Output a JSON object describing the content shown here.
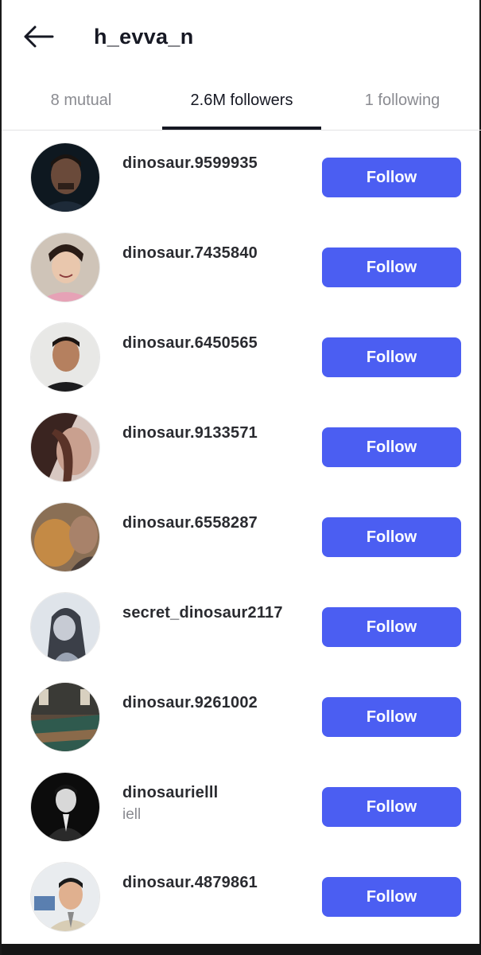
{
  "header": {
    "title": "h_evva_n",
    "back_icon": "arrow-left-icon"
  },
  "tabs": [
    {
      "label": "8 mutual",
      "active": false
    },
    {
      "label": "2.6M followers",
      "active": true
    },
    {
      "label": "1 following",
      "active": false
    }
  ],
  "colors": {
    "accent": "#4b5ef2",
    "text_primary": "#161823",
    "text_secondary": "#8a8b91"
  },
  "followers": [
    {
      "username": "dinosaur.9599935",
      "nickname": "",
      "button": "Follow"
    },
    {
      "username": "dinosaur.7435840",
      "nickname": "",
      "button": "Follow"
    },
    {
      "username": "dinosaur.6450565",
      "nickname": "",
      "button": "Follow"
    },
    {
      "username": "dinosaur.9133571",
      "nickname": "",
      "button": "Follow"
    },
    {
      "username": "dinosaur.6558287",
      "nickname": "",
      "button": "Follow"
    },
    {
      "username": "secret_dinosaur2117",
      "nickname": "",
      "button": "Follow"
    },
    {
      "username": "dinosaur.9261002",
      "nickname": "",
      "button": "Follow"
    },
    {
      "username": "dinosaurielll",
      "nickname": "iell",
      "button": "Follow"
    },
    {
      "username": "dinosaur.4879861",
      "nickname": "",
      "button": "Follow"
    }
  ]
}
